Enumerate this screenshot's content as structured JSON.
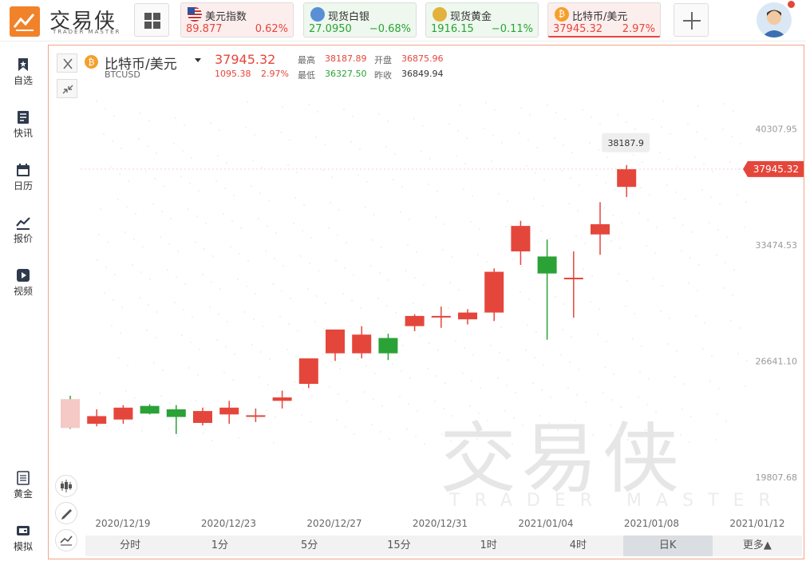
{
  "brand": {
    "name": "交易侠",
    "sub": "TRADER MASTER"
  },
  "tabs": [
    {
      "name": "美元指数",
      "price": "89.877",
      "change": "0.62%",
      "dir": "up",
      "icon": "us-flag-icon"
    },
    {
      "name": "现货白银",
      "price": "27.0950",
      "change": "−0.68%",
      "dir": "down",
      "icon": "silver-icon"
    },
    {
      "name": "现货黄金",
      "price": "1916.15",
      "change": "−0.11%",
      "dir": "down",
      "icon": "gold-icon"
    },
    {
      "name": "比特币/美元",
      "price": "37945.32",
      "change": "2.97%",
      "dir": "up",
      "icon": "bitcoin-icon"
    }
  ],
  "sidebar": {
    "top": [
      {
        "label": "自选",
        "icon": "bookmark-icon"
      },
      {
        "label": "快讯",
        "icon": "news-icon"
      },
      {
        "label": "日历",
        "icon": "calendar-icon"
      },
      {
        "label": "报价",
        "icon": "quote-icon"
      },
      {
        "label": "视频",
        "icon": "video-icon"
      }
    ],
    "bottom": [
      {
        "label": "黄金",
        "icon": "gold-doc-icon"
      },
      {
        "label": "模拟",
        "icon": "wallet-icon"
      }
    ]
  },
  "symbol": {
    "name": "比特币/美元",
    "code": "BTCUSD",
    "price": "37945.32",
    "change": "1095.38",
    "change_pct": "2.97%",
    "stats": {
      "high_label": "最高",
      "high": "38187.89",
      "open_label": "开盘",
      "open": "36875.96",
      "low_label": "最低",
      "low": "36327.50",
      "prev_label": "昨收",
      "prev": "36849.94"
    }
  },
  "colors": {
    "up": "#e5463b",
    "down": "#2aa236",
    "accent": "#f0832a"
  },
  "chart_data": {
    "type": "candlestick",
    "y_ticks": [
      19807.68,
      26641.1,
      33474.53,
      40307.95
    ],
    "y_tick_labels": [
      "19807.68",
      "26641.10",
      "33474.53",
      "40307.95"
    ],
    "x_labels": [
      "2020/12/19",
      "2020/12/23",
      "2020/12/27",
      "2020/12/31",
      "2021/01/04",
      "2021/01/08",
      "2021/01/12"
    ],
    "current_price": "37945.32",
    "high_marker": "38187.9",
    "ylim": [
      17500,
      42500
    ],
    "candles": [
      {
        "o": 24400,
        "h": 24600,
        "l": 22650,
        "c": 22700
      },
      {
        "o": 22950,
        "h": 23800,
        "l": 22800,
        "c": 23400
      },
      {
        "o": 23200,
        "h": 24050,
        "l": 22950,
        "c": 23900
      },
      {
        "o": 24000,
        "h": 24100,
        "l": 23500,
        "c": 23550
      },
      {
        "o": 23800,
        "h": 24050,
        "l": 22350,
        "c": 23350
      },
      {
        "o": 23000,
        "h": 23900,
        "l": 22850,
        "c": 23700
      },
      {
        "o": 23500,
        "h": 24300,
        "l": 22950,
        "c": 23900
      },
      {
        "o": 23450,
        "h": 23850,
        "l": 23050,
        "c": 23450
      },
      {
        "o": 24300,
        "h": 24900,
        "l": 23850,
        "c": 24500
      },
      {
        "o": 25300,
        "h": 26100,
        "l": 25050,
        "c": 26800
      },
      {
        "o": 27100,
        "h": 28000,
        "l": 26650,
        "c": 28500
      },
      {
        "o": 27100,
        "h": 28700,
        "l": 26800,
        "c": 28200
      },
      {
        "o": 28000,
        "h": 28250,
        "l": 26700,
        "c": 27100
      },
      {
        "o": 28700,
        "h": 29400,
        "l": 28400,
        "c": 29300
      },
      {
        "o": 29250,
        "h": 29850,
        "l": 28600,
        "c": 29300
      },
      {
        "o": 29100,
        "h": 29700,
        "l": 28800,
        "c": 29500
      },
      {
        "o": 29500,
        "h": 32100,
        "l": 29000,
        "c": 31900
      },
      {
        "o": 33100,
        "h": 34900,
        "l": 32300,
        "c": 34600
      },
      {
        "o": 32800,
        "h": 33800,
        "l": 27900,
        "c": 31800
      },
      {
        "o": 31550,
        "h": 33100,
        "l": 29200,
        "c": 31550
      },
      {
        "o": 34100,
        "h": 36000,
        "l": 32900,
        "c": 34700
      },
      {
        "o": 36900,
        "h": 38187.9,
        "l": 36300,
        "c": 37945.32
      }
    ]
  },
  "timeframes": [
    "分时",
    "1分",
    "5分",
    "15分",
    "1时",
    "4时",
    "日K",
    "更多▲"
  ],
  "active_timeframe": 6,
  "watermark": {
    "text": "交易侠",
    "sub": "TRADER MASTER"
  }
}
